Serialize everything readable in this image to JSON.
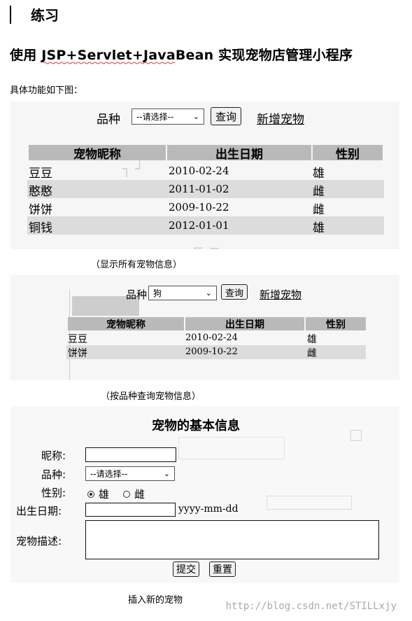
{
  "header": {
    "title": "练习",
    "subtitle": "使用 JSP+Servlet+JavaBean 实现宠物店管理小程序",
    "intro": "具体功能如下图："
  },
  "panel1": {
    "breed_label": "品种",
    "breed_select": "--请选择--",
    "query_button": "查询",
    "add_link": "新增宠物",
    "columns": [
      "宠物昵称",
      "出生日期",
      "性别"
    ],
    "rows": [
      [
        "豆豆",
        "2010-02-24",
        "雄"
      ],
      [
        "憨憨",
        "2011-01-02",
        "雌"
      ],
      [
        "饼饼",
        "2009-10-22",
        "雌"
      ],
      [
        "铜钱",
        "2012-01-01",
        "雄"
      ]
    ],
    "caption": "（显示所有宠物信息）"
  },
  "panel2": {
    "breed_label": "品种",
    "breed_select": "狗",
    "query_button": "查询",
    "add_link": "新增宠物",
    "columns": [
      "宠物昵称",
      "出生日期",
      "性别"
    ],
    "rows": [
      [
        "豆豆",
        "2010-02-24",
        "雄"
      ],
      [
        "饼饼",
        "2009-10-22",
        "雌"
      ]
    ],
    "caption": "（按品种查询宠物信息）"
  },
  "panel3": {
    "title": "宠物的基本信息",
    "nickname_label": "昵称:",
    "nickname_value": "",
    "breed_label": "品种:",
    "breed_select": "--请选择--",
    "gender_label": "性别:",
    "gender_options": [
      "雄",
      "雌"
    ],
    "birth_label": "出生日期:",
    "birth_value": "",
    "birth_hint": "yyyy-mm-dd",
    "desc_label": "宠物描述:",
    "desc_value": "",
    "submit_button": "提交",
    "reset_button": "重置",
    "caption": "插入新的宠物"
  },
  "watermark": "http://blog.csdn.net/STILLxjy",
  "colors": {
    "header_bg": "#b9b9b9",
    "alt_row": "#dcdcdc",
    "panel_bg": "#f6f6f6"
  }
}
